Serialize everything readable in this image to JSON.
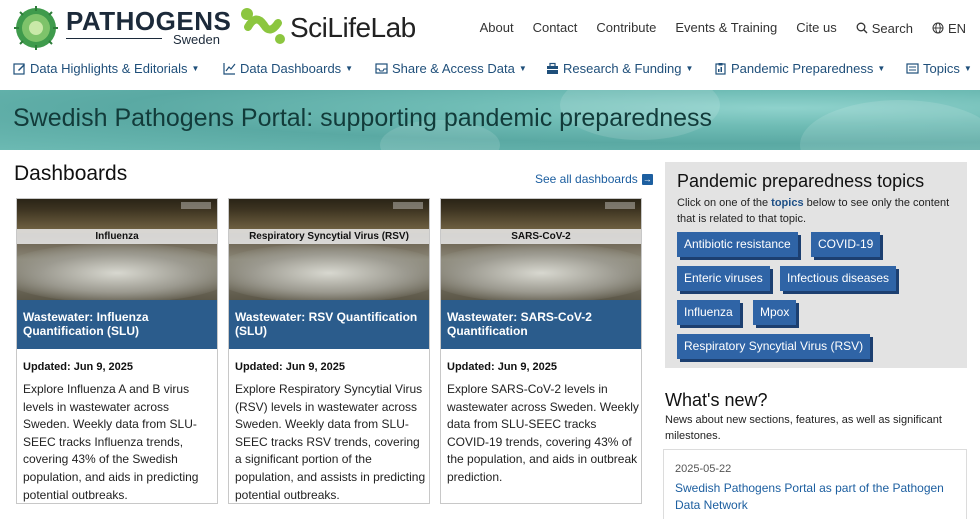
{
  "header": {
    "brand_main": "PATHOGENS",
    "brand_sub": "Sweden",
    "partner": "SciLifeLab",
    "topnav": [
      "About",
      "Contact",
      "Contribute",
      "Events & Training",
      "Cite us"
    ],
    "search_label": "Search",
    "lang_label": "EN"
  },
  "mainnav": {
    "items": [
      {
        "label": "Data Highlights & Editorials",
        "icon": "edit-icon"
      },
      {
        "label": "Data Dashboards",
        "icon": "chart-icon"
      },
      {
        "label": "Share & Access Data",
        "icon": "inbox-icon"
      },
      {
        "label": "Research & Funding",
        "icon": "briefcase-icon"
      },
      {
        "label": "Pandemic Preparedness",
        "icon": "clipboard-icon"
      },
      {
        "label": "Topics",
        "icon": "list-icon"
      }
    ]
  },
  "banner": {
    "title": "Swedish Pathogens Portal: supporting pandemic preparedness"
  },
  "dashboards": {
    "title": "Dashboards",
    "see_all": "See all dashboards",
    "cards": [
      {
        "image_tag": "Influenza",
        "title": "Wastewater: Influenza Quantification (SLU)",
        "updated": "Updated: Jun 9, 2025",
        "description": "Explore Influenza A and B virus levels in wastewater across Sweden. Weekly data from SLU-SEEC tracks Influenza trends, covering 43% of the Swedish population, and aids in predicting potential outbreaks."
      },
      {
        "image_tag": "Respiratory Syncytial Virus (RSV)",
        "title": "Wastewater: RSV Quantification (SLU)",
        "updated": "Updated: Jun 9, 2025",
        "description": "Explore Respiratory Syncytial Virus (RSV) levels in wastewater across Sweden. Weekly data from SLU-SEEC tracks RSV trends, covering a significant portion of the population, and assists in predicting potential outbreaks."
      },
      {
        "image_tag": "SARS-CoV-2",
        "title": "Wastewater: SARS-CoV-2 Quantification",
        "updated": "Updated: Jun 9, 2025",
        "description": "Explore SARS-CoV-2 levels in wastewater across Sweden. Weekly data from SLU-SEEC tracks COVID-19 trends, covering 43% of the population, and aids in outbreak prediction."
      }
    ]
  },
  "topics": {
    "title": "Pandemic preparedness topics",
    "intro_before": "Click on one of the ",
    "intro_link": "topics",
    "intro_after": " below to see only the content that is related to that topic.",
    "pills": [
      "Antibiotic resistance",
      "COVID-19",
      "Enteric viruses",
      "Infectious diseases",
      "Influenza",
      "Mpox",
      "Respiratory Syncytial Virus (RSV)"
    ]
  },
  "whats_new": {
    "title": "What's new?",
    "subtitle": "News about new sections, features, as well as significant milestones.",
    "items": [
      {
        "date": "2025-05-22",
        "title": "Swedish Pathogens Portal as part of the Pathogen Data Network"
      }
    ]
  },
  "colors": {
    "nav_blue": "#1f4f7a",
    "card_caption": "#2b5c8c",
    "pill": "#2f64a6",
    "banner_teal": "#6fbcb5",
    "scilife_green": "#8cc63f"
  }
}
